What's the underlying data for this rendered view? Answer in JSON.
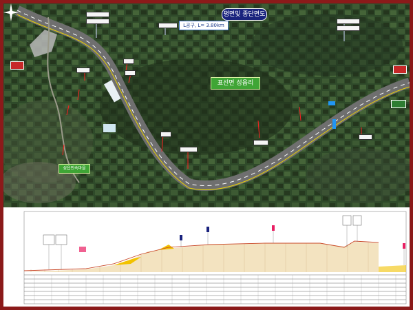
{
  "plan_title": "평면및 종단면도",
  "route_length_label": "L공구, L= 3.80km",
  "area_label": "표선면 성읍리",
  "village_label": "성읍민속마을",
  "colors": {
    "border": "#8b1a1a",
    "road": "#7d7d7d",
    "lane_marking": "#ffffff",
    "title_badge": "#1a237e",
    "area_badge": "#3fa535",
    "profile_fill": "#f3e3c0",
    "profile_line": "#c94a2a"
  },
  "icons": [
    "compass-rose-icon",
    "direction-sign-icon"
  ]
}
